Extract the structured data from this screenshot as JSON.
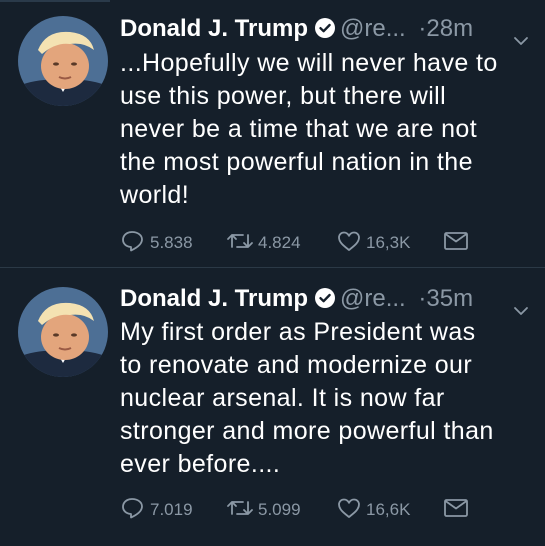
{
  "tweets": [
    {
      "name": "Donald J. Trump",
      "handle": "@re...",
      "time_sep": "·",
      "time": "28m",
      "text": "...Hopefully we will never have to\nuse this power, but there will\nnever be a time that we are not\nthe most powerful nation in the\nworld!",
      "replies": "5.838",
      "retweets": "4.824",
      "likes": "16,3K"
    },
    {
      "name": "Donald J. Trump",
      "handle": "@re...",
      "time_sep": "·",
      "time": "35m",
      "text": "My first order as President was\nto renovate and modernize our\nnuclear arsenal. It is now far\nstronger and more powerful than\never before....",
      "replies": "7.019",
      "retweets": "5.099",
      "likes": "16,6K"
    }
  ],
  "colors": {
    "background": "#151f2a",
    "text": "#ffffff",
    "muted": "#8b98a5",
    "divider": "#2b3946"
  },
  "icons": [
    "verified-icon",
    "chevron-down-icon",
    "reply-icon",
    "retweet-icon",
    "like-icon",
    "direct-message-icon"
  ]
}
